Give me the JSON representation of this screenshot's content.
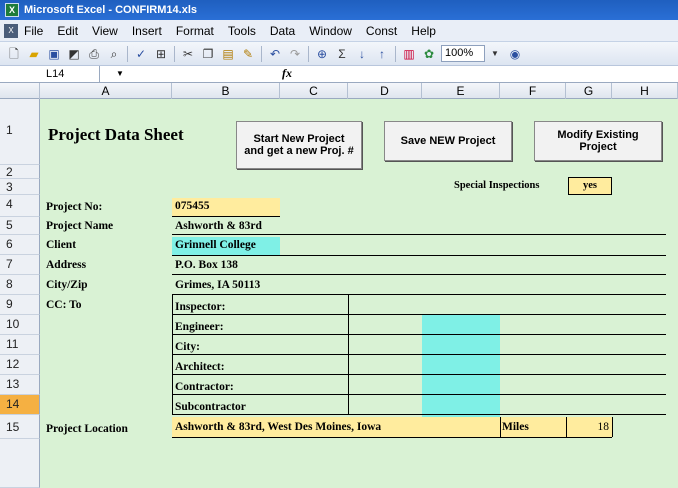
{
  "window": {
    "title": "Microsoft Excel - CONFIRM14.xls"
  },
  "menu": [
    "File",
    "Edit",
    "View",
    "Insert",
    "Format",
    "Tools",
    "Data",
    "Window",
    "Const",
    "Help"
  ],
  "toolbar": {
    "zoom": "100%"
  },
  "formula_bar": {
    "name_box": "L14",
    "fx": "fx"
  },
  "columns": [
    "A",
    "B",
    "C",
    "D",
    "E",
    "F",
    "G",
    "H"
  ],
  "rows": [
    "1",
    "2",
    "3",
    "4",
    "5",
    "6",
    "7",
    "8",
    "9",
    "10",
    "11",
    "12",
    "13",
    "14",
    "15"
  ],
  "selected_row": "14",
  "sheet": {
    "title": "Project Data Sheet",
    "buttons": {
      "start_new": "Start New Project and get a new Proj. #",
      "save_new": "Save NEW Project",
      "modify": "Modify Existing Project"
    },
    "special_inspections_label": "Special Inspections",
    "special_inspections_value": "yes",
    "project_no_label": "Project No:",
    "project_no": "075455",
    "project_name_label": "Project Name",
    "project_name": "Ashworth & 83rd",
    "client_label": "Client",
    "client": "Grinnell College",
    "address_label": "Address",
    "address": "P.O. Box 138",
    "cityzip_label": "City/Zip",
    "cityzip": "Grimes, IA  50113",
    "cc_label": "CC: To",
    "cc": [
      "Inspector:",
      "Engineer:",
      "City:",
      "Architect:",
      "Contractor:",
      "Subcontractor"
    ],
    "location_label": "Project Location",
    "location": "Ashworth & 83rd, West Des Moines, Iowa",
    "miles_label": "Miles",
    "miles": "18"
  },
  "colors": {
    "sheet_bg": "#d9f2d4",
    "highlight_yellow": "#ffec9e",
    "highlight_cyan": "#7ff0e6",
    "selected_row": "#f5b042"
  }
}
